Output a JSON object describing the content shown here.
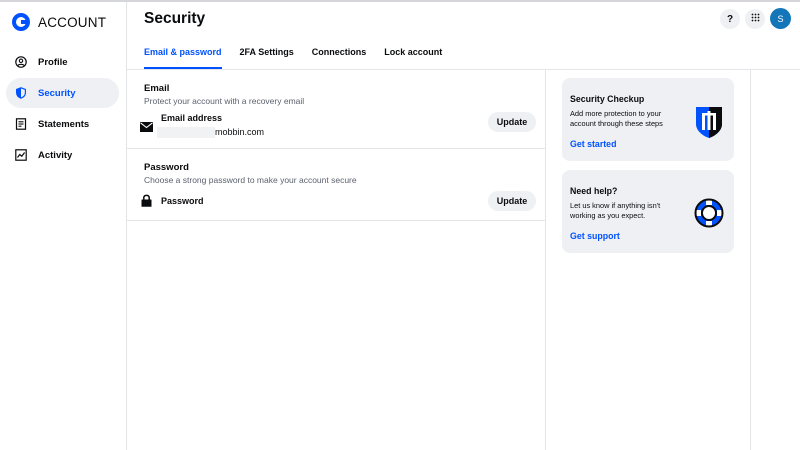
{
  "brand": {
    "name": "ACCOUNT",
    "accent": "#0052ff"
  },
  "sidebar": {
    "items": [
      {
        "label": "Profile",
        "icon": "user-circle-icon",
        "active": false
      },
      {
        "label": "Security",
        "icon": "shield-icon",
        "active": true
      },
      {
        "label": "Statements",
        "icon": "document-icon",
        "active": false
      },
      {
        "label": "Activity",
        "icon": "chart-line-icon",
        "active": false
      }
    ]
  },
  "header": {
    "title": "Security",
    "help_label": "?",
    "apps_icon": "grid-icon",
    "avatar_initial": "S",
    "avatar_color": "#1475b8"
  },
  "tabs": [
    {
      "label": "Email & password",
      "active": true
    },
    {
      "label": "2FA Settings",
      "active": false
    },
    {
      "label": "Connections",
      "active": false
    },
    {
      "label": "Lock account",
      "active": false
    }
  ],
  "email_section": {
    "title": "Email",
    "subtitle": "Protect your account with a recovery email",
    "row_label": "Email address",
    "row_value": "mobbin.com",
    "button": "Update",
    "icon": "envelope-icon"
  },
  "password_section": {
    "title": "Password",
    "subtitle": "Choose a strong password to make your account secure",
    "row_label": "Password",
    "button": "Update",
    "icon": "lock-icon"
  },
  "cards": {
    "checkup": {
      "title": "Security Checkup",
      "text": "Add more protection to your account through these steps",
      "link": "Get started",
      "illustration": "shield-badge-icon"
    },
    "help": {
      "title": "Need help?",
      "text": "Let us know if anything isn't working as you expect.",
      "link": "Get support",
      "illustration": "lifebuoy-icon"
    }
  }
}
